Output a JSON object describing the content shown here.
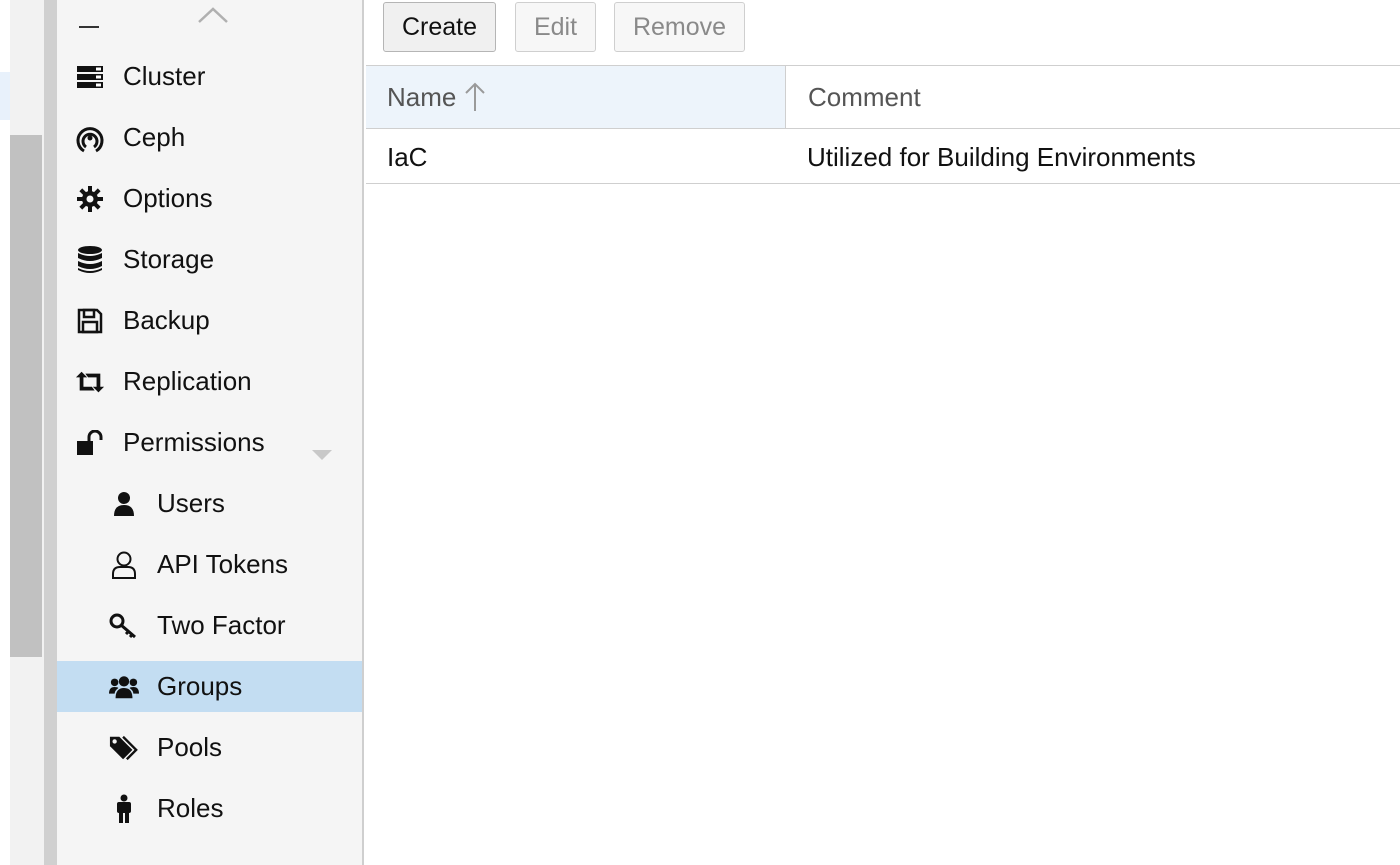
{
  "nav": {
    "items": [
      {
        "label": "Cluster",
        "icon": "server-icon"
      },
      {
        "label": "Ceph",
        "icon": "ceph-icon"
      },
      {
        "label": "Options",
        "icon": "gear-icon"
      },
      {
        "label": "Storage",
        "icon": "database-icon"
      },
      {
        "label": "Backup",
        "icon": "floppy-icon"
      },
      {
        "label": "Replication",
        "icon": "retweet-icon"
      },
      {
        "label": "Permissions",
        "icon": "unlock-icon"
      },
      {
        "label": "Users",
        "icon": "user-icon"
      },
      {
        "label": "API Tokens",
        "icon": "user-outline-icon"
      },
      {
        "label": "Two Factor",
        "icon": "key-icon"
      },
      {
        "label": "Groups",
        "icon": "users-icon",
        "active": true
      },
      {
        "label": "Pools",
        "icon": "tags-icon"
      },
      {
        "label": "Roles",
        "icon": "male-icon"
      }
    ]
  },
  "toolbar": {
    "create_label": "Create",
    "edit_label": "Edit",
    "remove_label": "Remove"
  },
  "grid": {
    "columns": [
      "Name",
      "Comment"
    ],
    "rows": [
      {
        "name": "IaC",
        "comment": "Utilized for Building Environments"
      }
    ]
  },
  "colors": {
    "active_bg": "#c3ddf2",
    "header_sorted_bg": "#edf4fb",
    "nav_bg": "#f5f5f5"
  }
}
